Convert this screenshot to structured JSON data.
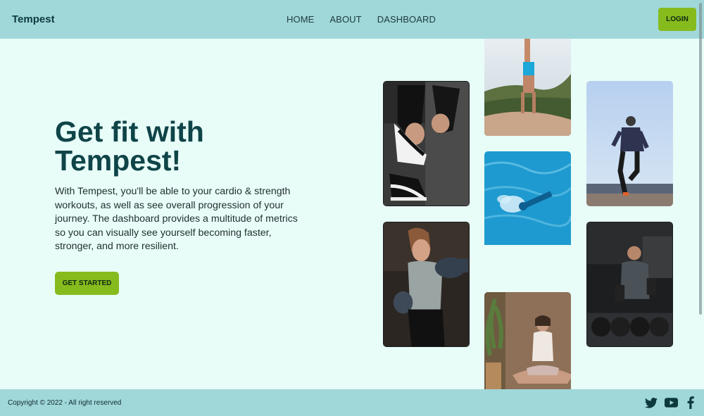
{
  "nav": {
    "brand": "Tempest",
    "links": [
      "HOME",
      "ABOUT",
      "DASHBOARD"
    ],
    "login_label": "LOGIN"
  },
  "hero": {
    "title": "Get fit with Tempest!",
    "body": "With Tempest, you'll be able to your cardio & strength workouts, as well as see overall progression of your journey. The dashboard provides a multitude of metrics so you can visually see yourself becoming faster, stronger, and more resilient.",
    "cta_label": "GET STARTED"
  },
  "gallery": [
    "sneaker-lacing-photo",
    "handstand-cliff-photo",
    "runner-sky-photo",
    "swimmer-pool-photo",
    "boxer-woman-photo",
    "dumbbell-man-photo",
    "yoga-meditation-photo"
  ],
  "footer": {
    "copyright": "Copyright © 2022 - All right reserved",
    "social": [
      "twitter-icon",
      "youtube-icon",
      "facebook-icon"
    ]
  },
  "colors": {
    "nav_bg": "#a0d8da",
    "page_bg": "#e8fdf8",
    "accent": "#86bb1e",
    "title": "#0f4448"
  }
}
